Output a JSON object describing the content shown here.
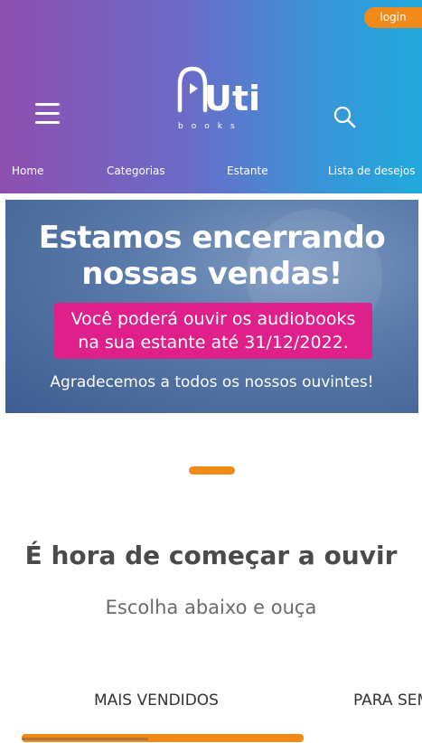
{
  "header": {
    "login_label": "login",
    "logo_text": "Uti",
    "logo_sub": "books",
    "nav": [
      {
        "label": "Home"
      },
      {
        "label": "Categorias"
      },
      {
        "label": "Estante"
      },
      {
        "label": "Lista de desejos"
      }
    ],
    "colors": {
      "gradient_start": "#8e4fb0",
      "gradient_end": "#1fa9dc",
      "accent": "#f28a1a"
    }
  },
  "banner": {
    "line1": "Estamos encerrando",
    "line2": "nossas vendas!",
    "pill_line1": "Você poderá ouvir os audiobooks",
    "pill_line2": "na sua estante até 31/12/2022.",
    "footer": "Agradecemos a todos os nossos ouvintes!",
    "pill_color": "#e0208a"
  },
  "section": {
    "title": "É hora de começar a ouvir",
    "subtitle": "Escolha abaixo e ouça"
  },
  "tabs": [
    {
      "label": "MAIS VENDIDOS",
      "active": true
    },
    {
      "label": "PARA SEMPRE",
      "active": false
    }
  ],
  "icons": {
    "menu": "hamburger-icon",
    "search": "search-icon"
  }
}
